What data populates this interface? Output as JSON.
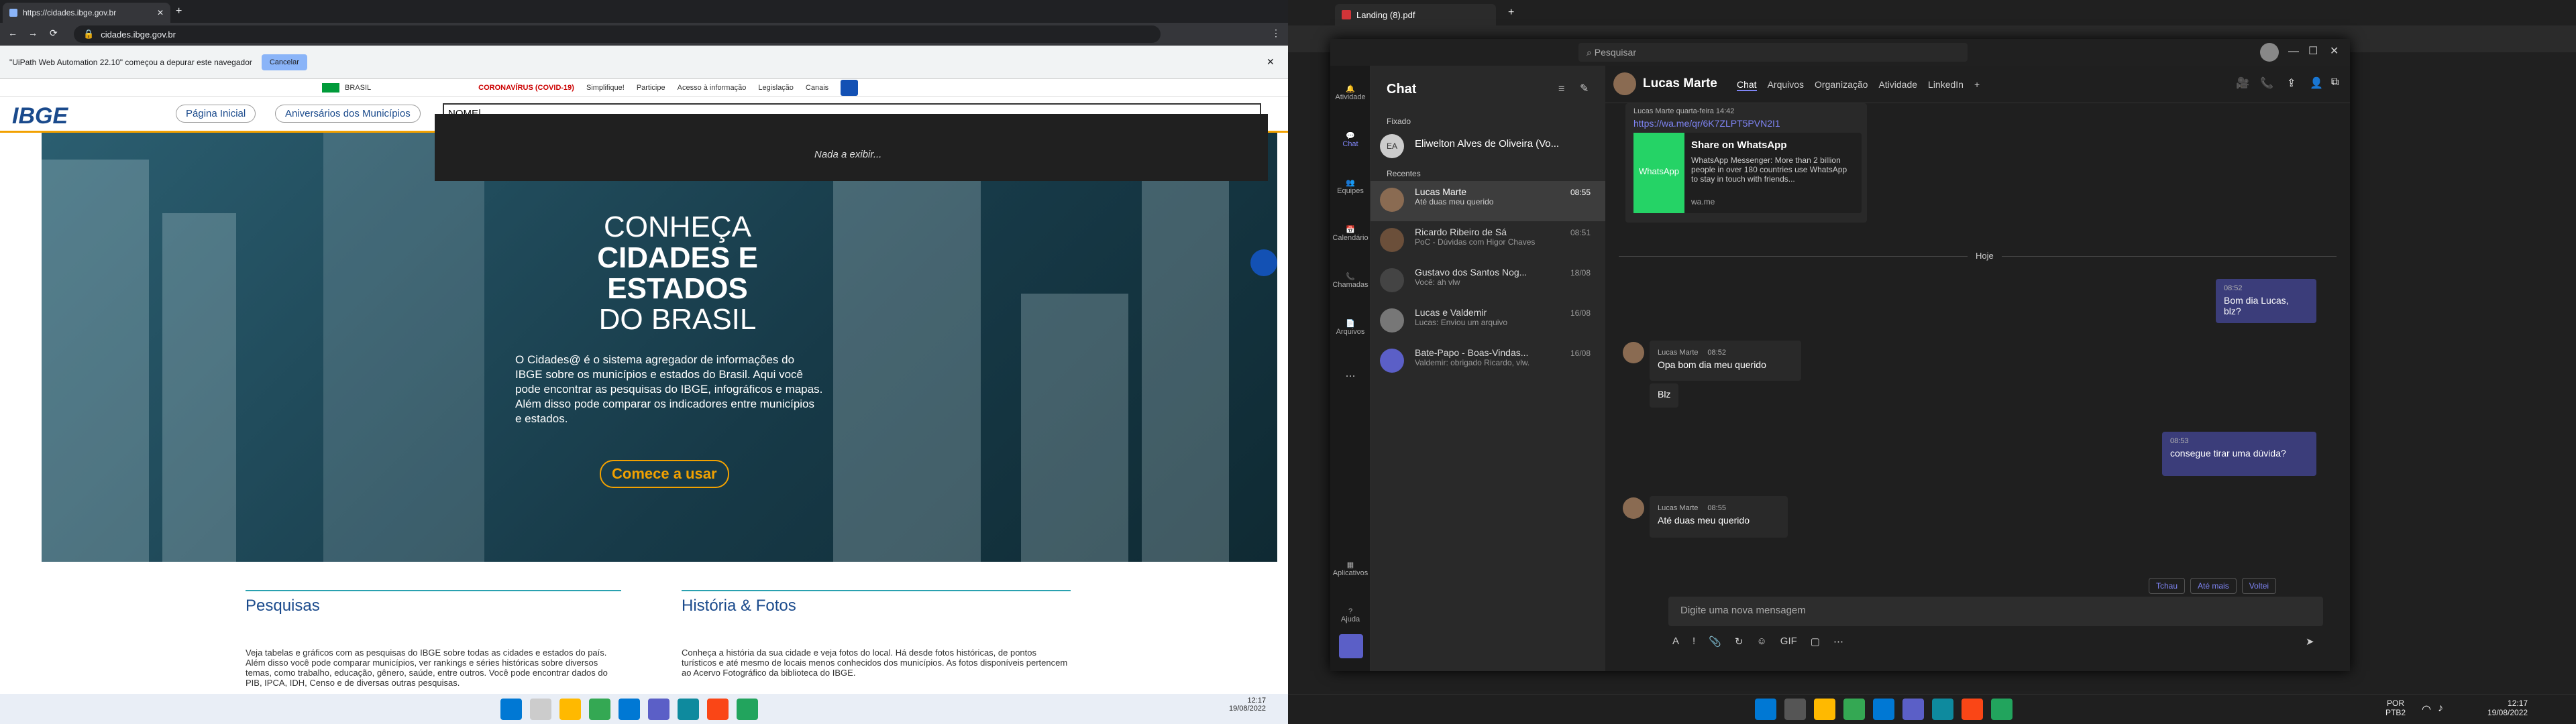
{
  "left": {
    "tab_title": "https://cidades.ibge.gov.br",
    "url": "cidades.ibge.gov.br",
    "infobar_text": "\"UiPath Web Automation 22.10\" começou a depurar este navegador",
    "infobar_cancel": "Cancelar",
    "gov_links": [
      "BRASIL",
      "CORONAVÍRUS (COVID-19)",
      "Simplifique!",
      "Participe",
      "Acesso à informação",
      "Legislação",
      "Canais"
    ],
    "logo": "IBGE",
    "nav_buttons": [
      "Página Inicial",
      "Aniversários dos Municípios"
    ],
    "search_value": "NOME|",
    "search_result": "Nada a exibir...",
    "hero_line1": "CONHEÇA",
    "hero_line2": "CIDADES E",
    "hero_line3": "ESTADOS",
    "hero_line4": "DO BRASIL",
    "hero_desc": "O Cidades@ é o sistema agregador de informações do IBGE sobre os municípios e estados do Brasil. Aqui você pode encontrar as pesquisas do IBGE, infográficos e mapas. Além disso pode comparar os indicadores entre municípios e estados.",
    "hero_button": "Comece a usar",
    "sec1_title": "Pesquisas",
    "sec1_text": "Veja tabelas e gráficos com as pesquisas do IBGE sobre todas as cidades e estados do país. Além disso você pode comparar municípios, ver rankings e séries históricas sobre diversos temas, como trabalho, educação, gênero, saúde, entre outros. Você pode encontrar dados do PIB, IPCA, IDH, Censo e de diversas outras pesquisas.",
    "sec2_title": "História & Fotos",
    "sec2_text": "Conheça a história da sua cidade e veja fotos do local. Há desde fotos históricas, de pontos turísticos e até mesmo de locais menos conhecidos dos municípios. As fotos disponíveis pertencem ao Acervo Fotográfico da biblioteca do IBGE.",
    "clock_time": "12:17",
    "clock_date": "19/08/2022"
  },
  "right": {
    "edge_tab": "Landing (8).pdf",
    "search_placeholder": "Pesquisar",
    "rail": [
      "Atividade",
      "Chat",
      "Equipes",
      "Calendário",
      "Chamadas",
      "Arquivos",
      "...",
      "Aplicativos",
      "Ajuda"
    ],
    "chat_header": "Chat",
    "pinned_label": "Fixado",
    "recent_label": "Recentes",
    "pinned": [
      {
        "name": "Eliwelton Alves de Oliveira (Vo...",
        "initials": "EA"
      }
    ],
    "chats": [
      {
        "name": "Lucas Marte",
        "preview": "Até duas meu querido",
        "time": "08:55"
      },
      {
        "name": "Ricardo Ribeiro de Sá",
        "preview": "PoC - Dúvidas com Higor Chaves",
        "time": "08:51"
      },
      {
        "name": "Gustavo dos Santos Nog...",
        "preview": "Você: ah vlw",
        "time": "18/08"
      },
      {
        "name": "Lucas e Valdemir",
        "preview": "Lucas: Enviou um arquivo",
        "time": "16/08"
      },
      {
        "name": "Bate-Papo - Boas-Vindas...",
        "preview": "Valdemir: obrigado Ricardo, vlw.",
        "time": "16/08"
      }
    ],
    "conv_name": "Lucas Marte",
    "conv_tabs": [
      "Chat",
      "Arquivos",
      "Organização",
      "Atividade",
      "LinkedIn",
      "+"
    ],
    "old_msg_meta": "Lucas Marte   quarta-feira 14:42",
    "old_msg_link": "https://wa.me/qr/6K7ZLPT5PVN2I1",
    "card_title": "Share on WhatsApp",
    "card_desc": "WhatsApp Messenger: More than 2 billion people in over 180 countries use WhatsApp to stay in touch with friends...",
    "card_domain": "wa.me",
    "card_logo": "WhatsApp",
    "divider": "Hoje",
    "msgs": [
      {
        "who": "me",
        "time": "08:52",
        "text": "Bom dia Lucas, blz?"
      },
      {
        "who": "Lucas Marte",
        "time": "08:52",
        "text": "Opa bom dia meu querido",
        "extra": "Blz"
      },
      {
        "who": "me",
        "time": "08:53",
        "text": "consegue tirar uma dúvida?"
      },
      {
        "who": "Lucas Marte",
        "time": "08:55",
        "text": "Até duas meu querido"
      }
    ],
    "quick_replies": [
      "Tchau",
      "Até mais",
      "Voltei"
    ],
    "compose_placeholder": "Digite uma nova mensagem",
    "tray_lang1": "POR",
    "tray_lang2": "PTB2",
    "clock_time": "12:17",
    "clock_date": "19/08/2022"
  }
}
